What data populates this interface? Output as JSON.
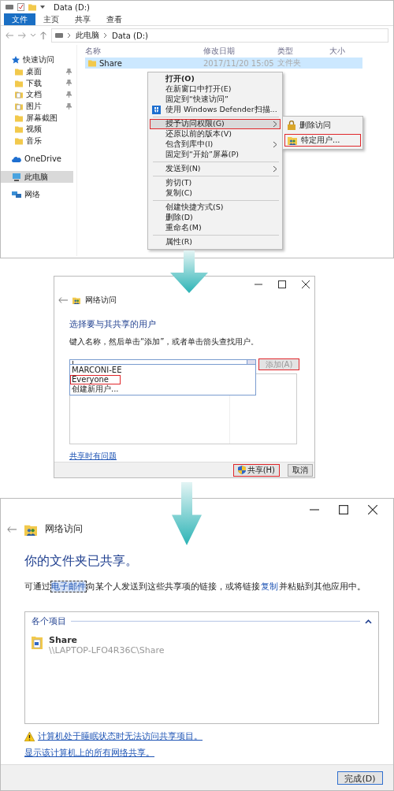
{
  "explorer": {
    "title": "Data (D:)",
    "ribbon_tabs": [
      {
        "label": "文件",
        "selected": true
      },
      {
        "label": "主页",
        "selected": false
      },
      {
        "label": "共享",
        "selected": false
      },
      {
        "label": "查看",
        "selected": false
      }
    ],
    "breadcrumb": [
      "此电脑",
      "Data (D:)"
    ],
    "sidebar": [
      {
        "label": "快速访问",
        "kind": "star",
        "pinned": false,
        "selected": false
      },
      {
        "label": "桌面",
        "kind": "folder",
        "pinned": true,
        "selected": false
      },
      {
        "label": "下载",
        "kind": "folder",
        "pinned": true,
        "selected": false
      },
      {
        "label": "文档",
        "kind": "doc",
        "pinned": true,
        "selected": false
      },
      {
        "label": "图片",
        "kind": "doc",
        "pinned": true,
        "selected": false
      },
      {
        "label": "屏幕截图",
        "kind": "folder",
        "pinned": false,
        "selected": false
      },
      {
        "label": "视频",
        "kind": "folder",
        "pinned": false,
        "selected": false
      },
      {
        "label": "音乐",
        "kind": "folder",
        "pinned": false,
        "selected": false
      },
      {
        "label": "OneDrive",
        "kind": "cloud",
        "pinned": false,
        "selected": false
      },
      {
        "label": "此电脑",
        "kind": "pc",
        "pinned": false,
        "selected": true
      },
      {
        "label": "网络",
        "kind": "network",
        "pinned": false,
        "selected": false
      }
    ],
    "columns": [
      "名称",
      "修改日期",
      "类型",
      "大小"
    ],
    "rows": [
      {
        "name": "Share",
        "modified": "2017/11/20 15:05",
        "type": "文件夹",
        "selected": true
      }
    ],
    "context_menu": [
      {
        "kind": "item",
        "label": "打开(O)",
        "bold": true,
        "submenu": false,
        "selected": false,
        "marked": false
      },
      {
        "kind": "item",
        "label": "在新窗口中打开(E)",
        "bold": false,
        "submenu": false,
        "selected": false,
        "marked": false
      },
      {
        "kind": "item",
        "label": "固定到“快速访问”",
        "bold": false,
        "submenu": false,
        "selected": false,
        "marked": false
      },
      {
        "kind": "shield",
        "label": "使用 Windows Defender扫描...",
        "bold": false,
        "submenu": false,
        "selected": false,
        "marked": false
      },
      {
        "kind": "separator"
      },
      {
        "kind": "item",
        "label": "授予访问权限(G)",
        "bold": false,
        "submenu": true,
        "selected": true,
        "marked": true
      },
      {
        "kind": "item",
        "label": "还原以前的版本(V)",
        "bold": false,
        "submenu": false,
        "selected": false,
        "marked": false
      },
      {
        "kind": "item",
        "label": "包含到库中(I)",
        "bold": false,
        "submenu": true,
        "selected": false,
        "marked": false
      },
      {
        "kind": "item",
        "label": "固定到“开始”屏幕(P)",
        "bold": false,
        "submenu": false,
        "selected": false,
        "marked": false
      },
      {
        "kind": "separator"
      },
      {
        "kind": "item",
        "label": "发送到(N)",
        "bold": false,
        "submenu": true,
        "selected": false,
        "marked": false
      },
      {
        "kind": "separator"
      },
      {
        "kind": "item",
        "label": "剪切(T)",
        "bold": false,
        "submenu": false,
        "selected": false,
        "marked": false
      },
      {
        "kind": "item",
        "label": "复制(C)",
        "bold": false,
        "submenu": false,
        "selected": false,
        "marked": false
      },
      {
        "kind": "separator"
      },
      {
        "kind": "item",
        "label": "创建快捷方式(S)",
        "bold": false,
        "submenu": false,
        "selected": false,
        "marked": false
      },
      {
        "kind": "item",
        "label": "删除(D)",
        "bold": false,
        "submenu": false,
        "selected": false,
        "marked": false
      },
      {
        "kind": "item",
        "label": "重命名(M)",
        "bold": false,
        "submenu": false,
        "selected": false,
        "marked": false
      },
      {
        "kind": "separator"
      },
      {
        "kind": "item",
        "label": "属性(R)",
        "bold": false,
        "submenu": false,
        "selected": false,
        "marked": false
      }
    ],
    "submenu": [
      {
        "kind": "lock",
        "label": "删除访问",
        "marked": false
      },
      {
        "kind": "users",
        "label": "特定用户...",
        "marked": true
      }
    ]
  },
  "share_dialog": {
    "title": "网络访问",
    "heading": "选择要与其共享的用户",
    "instruction": "键入名称，然后单击“添加”，或者单击箭头查找用户。",
    "add_button": {
      "label": "添加(A)",
      "disabled": true,
      "marked": true
    },
    "dropdown": [
      {
        "label": "MARCONI-EE",
        "marked": false
      },
      {
        "label": "Everyone",
        "marked": true
      },
      {
        "label": "创建新用户...",
        "marked": false
      }
    ],
    "help_link": "共享时有问题",
    "buttons": [
      {
        "label": "共享(H)",
        "kind": "shield",
        "marked": true
      },
      {
        "label": "取消",
        "kind": "plain",
        "marked": false
      }
    ]
  },
  "shared_dialog": {
    "title": "网络访问",
    "heading": "你的文件夹已共享。",
    "message": [
      {
        "kind": "text",
        "text": "可通过"
      },
      {
        "kind": "link",
        "text": "电子邮件",
        "focused": true
      },
      {
        "kind": "text",
        "text": "向某个人发送到这些共享项的链接，或将链接"
      },
      {
        "kind": "link",
        "text": "复制",
        "focused": false
      },
      {
        "kind": "text",
        "text": "并粘贴到其他应用中。"
      }
    ],
    "group": {
      "title": "各个项目",
      "expanded": true,
      "items": [
        {
          "name": "Share",
          "path": "\\\\LAPTOP-LFO4R36C\\Share"
        }
      ]
    },
    "links": [
      {
        "kind": "warning",
        "text": "计算机处于睡眠状态时无法访问共享项目。"
      },
      {
        "kind": "plain",
        "text": "显示该计算机上的所有网络共享。"
      }
    ],
    "done_button": "完成(D)"
  }
}
